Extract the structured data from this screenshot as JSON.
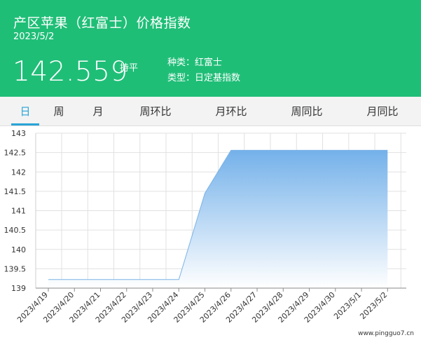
{
  "header": {
    "title": "产区苹果（红富士）价格指数",
    "date": "2023/5/2",
    "price": "142.559",
    "trend": "持平",
    "variety_label": "种类：红富士",
    "type_label": "类型：日定基指数",
    "bg_color": "#1fbe77"
  },
  "tabs": [
    {
      "label": "日",
      "active": true
    },
    {
      "label": "周",
      "active": false
    },
    {
      "label": "月",
      "active": false
    },
    {
      "label": "周环比",
      "active": false
    },
    {
      "label": "月环比",
      "active": false
    },
    {
      "label": "周同比",
      "active": false
    },
    {
      "label": "月同比",
      "active": false
    }
  ],
  "watermark": "www.pingguo7.cn",
  "chart_data": {
    "type": "area",
    "x": [
      "2023/4/19",
      "2023/4/20",
      "2023/4/21",
      "2023/4/22",
      "2023/4/23",
      "2023/4/24",
      "2023/4/25",
      "2023/4/26",
      "2023/4/27",
      "2023/4/28",
      "2023/4/29",
      "2023/4/30",
      "2023/5/1",
      "2023/5/2"
    ],
    "series": [
      {
        "values": [
          139.22,
          139.22,
          139.22,
          139.22,
          139.22,
          139.22,
          141.45,
          142.559,
          142.559,
          142.559,
          142.559,
          142.559,
          142.559,
          142.559
        ]
      }
    ],
    "yticks": [
      139,
      139.5,
      140,
      140.5,
      141,
      141.5,
      142,
      142.5,
      143
    ],
    "ylim": [
      139,
      143
    ],
    "grid": true,
    "line_color": "#7bb3e6"
  }
}
